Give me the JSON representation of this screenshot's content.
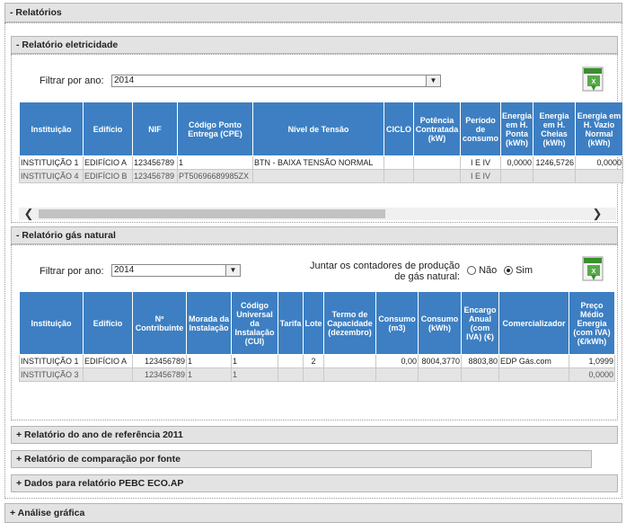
{
  "main": {
    "title": "- Relatórios"
  },
  "eletricidade": {
    "title": "- Relatório eletricidade",
    "filter_label": "Filtrar por ano:",
    "year": "2014",
    "headers": [
      "Instituição",
      "Edifício",
      "NIF",
      "Código Ponto Entrega (CPE)",
      "Nível de Tensão",
      "CICLO",
      "Potência Contratada (kW)",
      "Período de consumo",
      "Energia em H. Ponta (kWh)",
      "Energia em H. Cheias (kWh)",
      "Energia em H. Vazio Normal (kWh)"
    ],
    "rows": [
      [
        "INSTITUIÇÃO 1",
        "EDIFÍCIO A",
        "123456789",
        "1",
        "BTN - BAIXA TENSÃO NORMAL",
        "",
        "",
        "I E IV",
        "0,0000",
        "1246,5726",
        "0,0000"
      ],
      [
        "INSTITUIÇÃO 4",
        "EDIFÍCIO B",
        "123456789",
        "PT50696689985ZX",
        "",
        "",
        "",
        "I E IV",
        "",
        "",
        ""
      ]
    ]
  },
  "gas": {
    "title": "- Relatório gás natural",
    "filter_label": "Filtrar por ano:",
    "year": "2014",
    "merge_label": "Juntar os contadores de produção de gás natural:",
    "option_no": "Não",
    "option_yes": "Sim",
    "selected": "Sim",
    "headers": [
      "Instituição",
      "Edifício",
      "Nº Contribuinte",
      "Morada da Instalação",
      "Código Universal da Instalação (CUI)",
      "Tarifa",
      "Lote",
      "Termo de Capacidade (dezembro)",
      "Consumo (m3)",
      "Consumo (kWh)",
      "Encargo Anual (com IVA) (€)",
      "Comercializador",
      "Preço Médio Energia (com IVA) (€/kWh)"
    ],
    "rows": [
      [
        "INSTITUIÇÃO 1",
        "EDIFÍCIO A",
        "123456789",
        "1",
        "1",
        "",
        "2",
        "",
        "0,00",
        "8004,3770",
        "8803,80",
        "EDP Gás.com",
        "1,0999"
      ],
      [
        "INSTITUIÇÃO 3",
        "",
        "123456789",
        "1",
        "1",
        "",
        "",
        "",
        "",
        "",
        "",
        "",
        "0,0000"
      ]
    ]
  },
  "sections": {
    "ref2011": "+ Relatório do ano de referência 2011",
    "comparacao": "+ Relatório de comparação por fonte",
    "pebc": "+ Dados para relatório PEBC ECO.AP",
    "analise": "+ Análise gráfica"
  },
  "excel_label": "Excel",
  "scroll": {
    "left": "❮",
    "right": "❯"
  },
  "colors": {
    "header_blue": "#3d7fc2",
    "panel_gray": "#e3e3e3",
    "excel_green": "#3a8f2f"
  }
}
